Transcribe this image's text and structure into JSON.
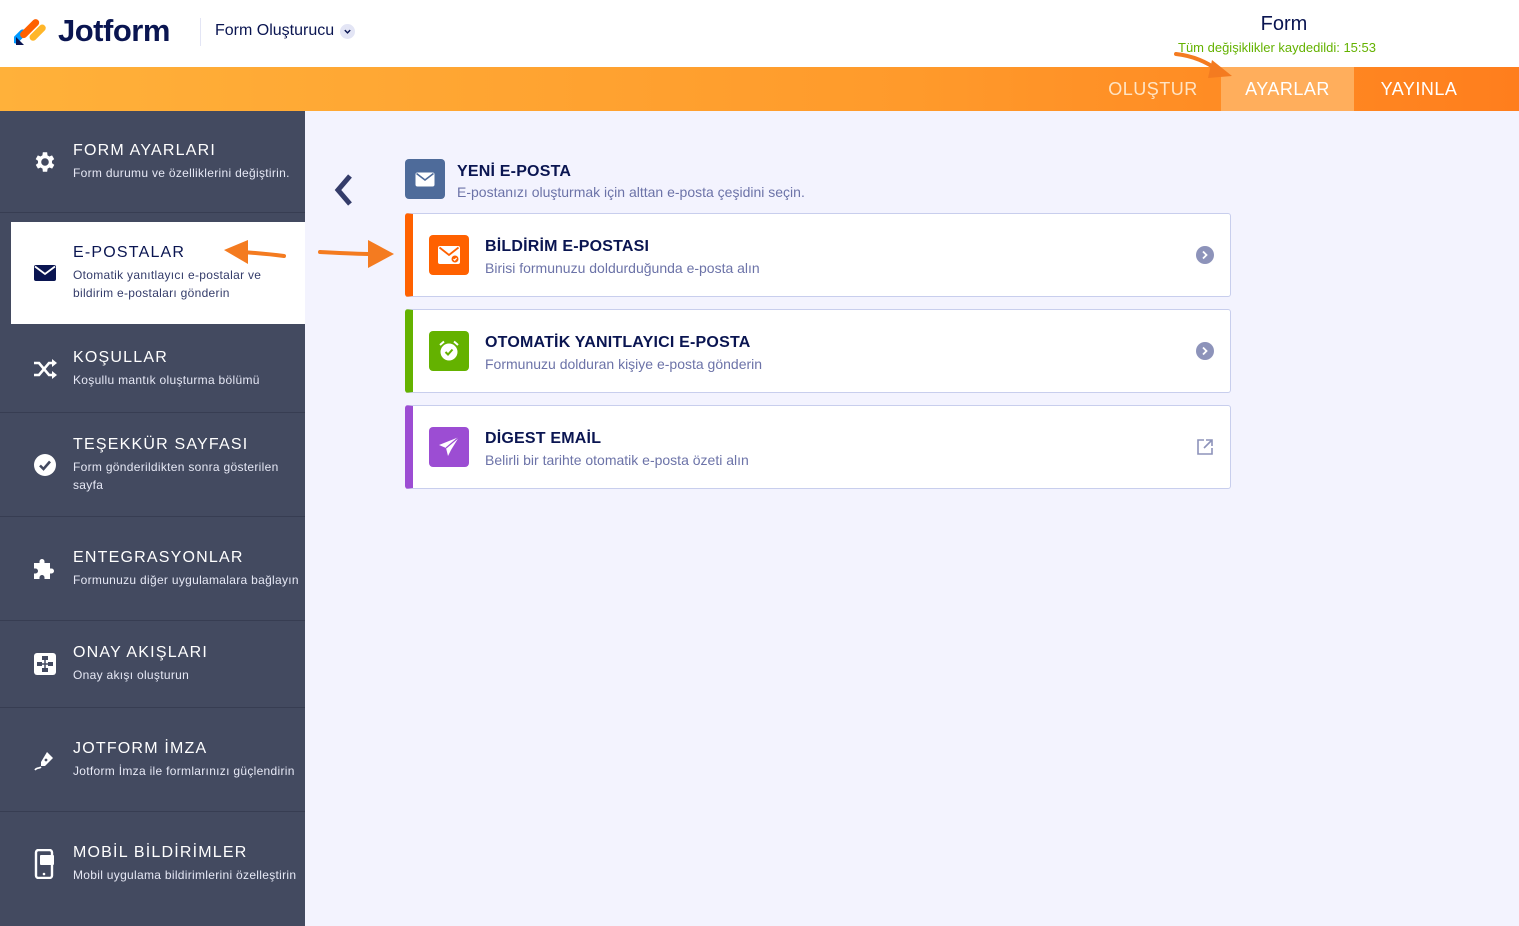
{
  "header": {
    "logo_text": "Jotform",
    "builder_label": "Form Oluşturucu",
    "form_title": "Form",
    "saved_status": "Tüm değişiklikler kaydedildi: 15:53"
  },
  "nav_tabs": [
    {
      "label": "OLUŞTUR",
      "active": false
    },
    {
      "label": "AYARLAR",
      "active": true
    },
    {
      "label": "YAYINLA",
      "active": false
    }
  ],
  "sidebar": {
    "items": [
      {
        "title": "FORM AYARLARI",
        "subtitle": "Form durumu ve özelliklerini değiştirin.",
        "icon": "gear-icon"
      },
      {
        "title": "E-POSTALAR",
        "subtitle": "Otomatik yanıtlayıcı e-postalar ve bildirim e-postaları gönderin",
        "icon": "envelope-icon",
        "active": true
      },
      {
        "title": "KOŞULLAR",
        "subtitle": "Koşullu mantık oluşturma bölümü",
        "icon": "shuffle-icon"
      },
      {
        "title": "TEŞEKKÜR SAYFASI",
        "subtitle": "Form gönderildikten sonra gösterilen sayfa",
        "icon": "check-circle-icon"
      },
      {
        "title": "ENTEGRASYONLAR",
        "subtitle": "Formunuzu diğer uygulamalara bağlayın",
        "icon": "puzzle-icon"
      },
      {
        "title": "ONAY AKIŞLARI",
        "subtitle": "Onay akışı oluşturun",
        "icon": "flow-icon"
      },
      {
        "title": "JOTFORM İMZA",
        "subtitle": "Jotform İmza ile formlarınızı güçlendirin",
        "icon": "pen-icon"
      },
      {
        "title": "MOBİL BİLDİRİMLER",
        "subtitle": "Mobil uygulama bildirimlerini özelleştirin",
        "icon": "mobile-icon"
      }
    ]
  },
  "main": {
    "new_email_title": "YENİ E-POSTA",
    "new_email_subtitle": "E-postanızı oluşturmak için alttan e-posta çeşidini seçin.",
    "cards": [
      {
        "title": "BİLDİRİM E-POSTASI",
        "subtitle": "Birisi formunuzu doldurduğunda e-posta alın",
        "color": "#ff6100",
        "icon": "notification-mail-icon"
      },
      {
        "title": "OTOMATİK YANITLAYICI E-POSTA",
        "subtitle": "Formunuzu dolduran kişiye e-posta gönderin",
        "color": "#64b200",
        "icon": "alarm-clock-icon"
      },
      {
        "title": "DİGEST EMAİL",
        "subtitle": "Belirli bir tarihte otomatik e-posta özeti alın",
        "color": "#9c4dd3",
        "icon": "paper-plane-icon"
      }
    ]
  },
  "colors": {
    "orange": "#ff8a20",
    "sidebar_bg": "#434a60",
    "accent_green": "#64b200",
    "annotation_arrow": "#f47b20"
  }
}
